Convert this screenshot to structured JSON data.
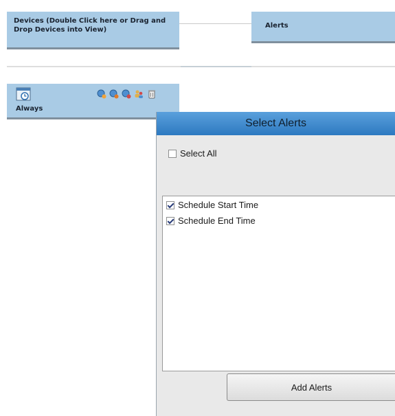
{
  "workflow": {
    "devices_label": "Devices (Double Click here or Drag and Drop Devices into View)",
    "alerts_label": "Alerts"
  },
  "schedule": {
    "label": "Always",
    "icons": [
      "calendar-clock-icon",
      "globe-add-icon",
      "globe-edit-icon",
      "globe-remove-icon",
      "users-icon",
      "trash-icon"
    ]
  },
  "dialog": {
    "title": "Select Alerts",
    "select_all_label": "Select All",
    "select_all_checked": false,
    "items": [
      {
        "label": "Schedule Start Time",
        "checked": true
      },
      {
        "label": "Schedule End Time",
        "checked": true
      }
    ],
    "add_button_label": "Add Alerts"
  },
  "colors": {
    "flow_box": "#a9cbe5",
    "dialog_title": "#3f8bd0",
    "dialog_bg": "#e9e9e9"
  }
}
